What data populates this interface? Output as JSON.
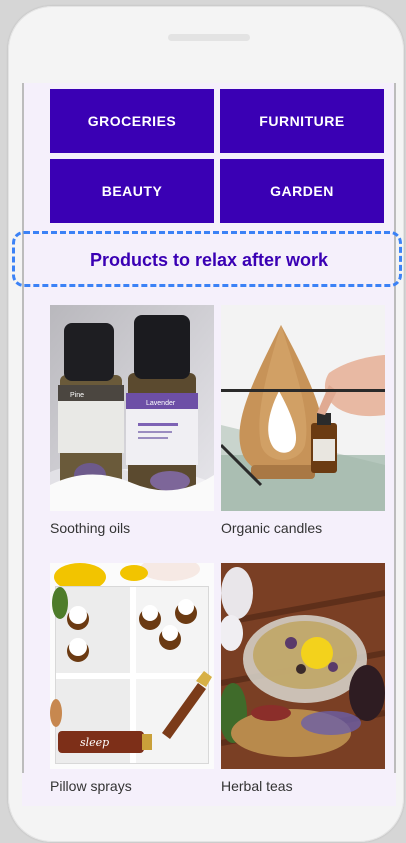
{
  "categories": [
    "GROCERIES",
    "FURNITURE",
    "BEAUTY",
    "GARDEN"
  ],
  "section": {
    "title": "Products to relax after work"
  },
  "products": [
    {
      "name": "Soothing oils",
      "image": "essential-oil-bottles",
      "label_1": "Pine",
      "label_2": "Lavender"
    },
    {
      "name": "Organic candles",
      "image": "aroma-diffuser"
    },
    {
      "name": "Pillow sprays",
      "image": "shelf-with-bottles",
      "label": "sleep"
    },
    {
      "name": "Herbal teas",
      "image": "tea-cup-with-herbs"
    }
  ],
  "colors": {
    "accent": "#3a00b4",
    "background": "#f5f0fb",
    "focus": "#3b82f6"
  }
}
